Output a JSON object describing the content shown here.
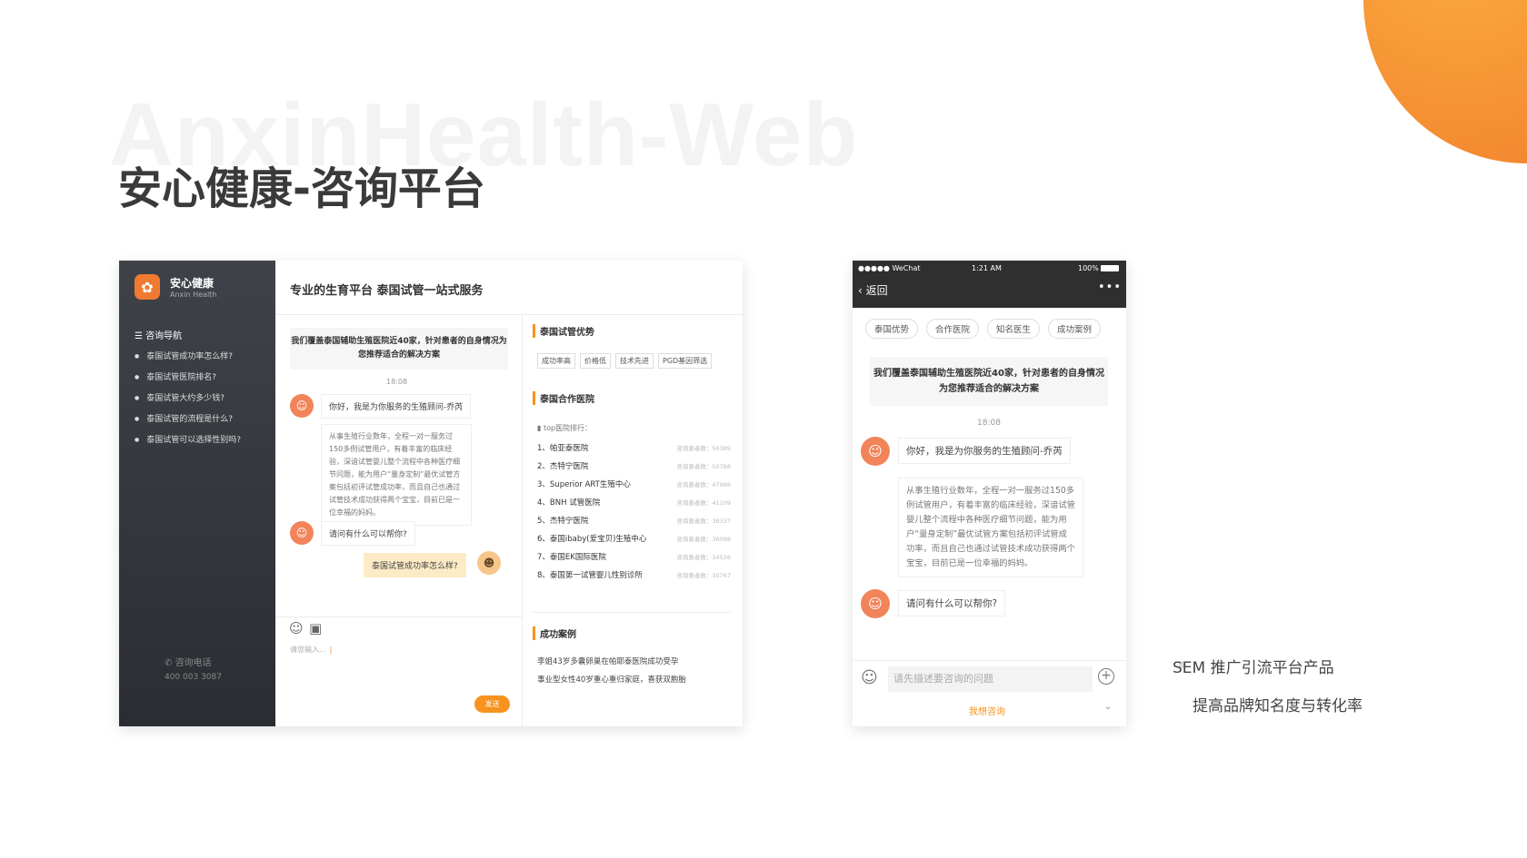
{
  "watermark": "AnxinHealth-Web",
  "title": "安心健康-咨询平台",
  "desktop": {
    "brand": "安心健康",
    "brand_sub": "Anxin Health",
    "nav_title": "咨询导航",
    "nav": [
      "泰国试管成功率怎么样?",
      "泰国试管医院排名?",
      "泰国试管大约多少钱?",
      "泰国试管的流程是什么?",
      "泰国试管可以选择性别吗?"
    ],
    "phone_label": "咨询电话",
    "phone": "400 003 3087",
    "header": "专业的生育平台 泰国试管一站式服务",
    "intro": "我们覆盖泰国辅助生殖医院近40家，针对患者的自身情况为您推荐适合的解决方案",
    "time": "18:08",
    "greet": "你好，我是为你服务的生殖顾问-乔芮",
    "long": "从事生殖行业数年，全程一对一服务过150多例试管用户，有着丰富的临床经验，深谙试管婴儿整个流程中各种医疗细节问题，能为用户“量身定制”最优试管方案包括初评试管成功率，而且自己也通过试管技术成功获得两个宝宝，目前已是一位幸福的妈妈。",
    "ask": "请问有什么可以帮你?",
    "user": "泰国试管成功率怎么样?",
    "input_ph": "请您输入...",
    "send": "发送",
    "sec1": "泰国试管优势",
    "tags": [
      "成功率高",
      "价格低",
      "技术先进",
      "PGD基因筛选"
    ],
    "sec2": "泰国合作医院",
    "top": "top医院排行：",
    "hospitals": [
      {
        "name": "1、帕亚泰医院",
        "count": "咨询患者数：56389"
      },
      {
        "name": "2、杰特宁医院",
        "count": "咨询患者数：50788"
      },
      {
        "name": "3、Superior ART生殖中心",
        "count": "咨询患者数：47986"
      },
      {
        "name": "4、BNH 试管医院",
        "count": "咨询患者数：41109"
      },
      {
        "name": "5、杰特宁医院",
        "count": "咨询患者数：38337"
      },
      {
        "name": "6、泰国ibaby(爱宝贝)生殖中心",
        "count": "咨询患者数：36098"
      },
      {
        "name": "7、泰国EK国际医院",
        "count": "咨询患者数：34526"
      },
      {
        "name": "8、泰国第一试管婴儿性别诊所",
        "count": "咨询患者数：30767"
      }
    ],
    "sec3": "成功案例",
    "cases": [
      "李姐43岁多囊卵巢在帕耶泰医院成功受孕",
      "事业型女性40岁重心重归家庭，喜获双胞胎"
    ]
  },
  "mobile": {
    "carrier": "●●●●● WeChat",
    "clock": "1:21 AM",
    "battery": "100%",
    "back": "返回",
    "more": "•••",
    "tabs": [
      "泰国优势",
      "合作医院",
      "知名医生",
      "成功案例"
    ],
    "intro": "我们覆盖泰国辅助生殖医院近40家，针对患者的自身情况为您推荐适合的解决方案",
    "time": "18:08",
    "greet": "你好，我是为你服务的生殖顾问-乔芮",
    "long": "从事生殖行业数年，全程一对一服务过150多例试管用户，有着丰富的临床经验，深谙试管婴儿整个流程中各种医疗细节问题，能为用户“量身定制”最优试管方案包括初评试管成功率，而且自己也通过试管技术成功获得两个宝宝，目前已是一位幸福的妈妈。",
    "ask": "请问有什么可以帮你?",
    "input_ph": "请先描述要咨询的问题",
    "consult": "我想咨询"
  },
  "bullets": [
    "SEM 推广引流平台产品",
    "提高品牌知名度与转化率"
  ],
  "colors": {
    "accent": "#f7931e",
    "sidebar": "#2f3237"
  }
}
